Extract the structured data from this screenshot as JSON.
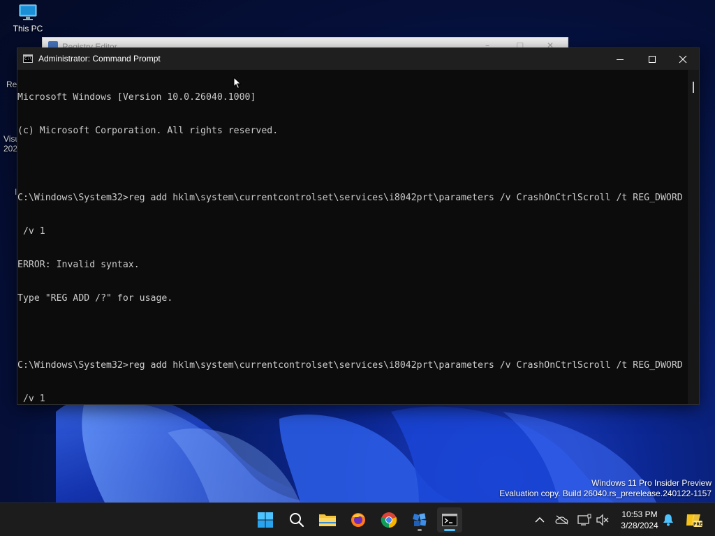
{
  "desktop": {
    "icons": [
      {
        "label": "This PC",
        "icon": "monitor-icon"
      }
    ],
    "partial_labels": [
      "Re",
      "Visu",
      "202",
      "I"
    ],
    "background_window_title": "Registry Editor"
  },
  "console": {
    "title": "Administrator: Command Prompt",
    "lines": [
      "Microsoft Windows [Version 10.0.26040.1000]",
      "(c) Microsoft Corporation. All rights reserved.",
      "",
      "C:\\Windows\\System32>reg add hklm\\system\\currentcontrolset\\services\\i8042prt\\parameters /v CrashOnCtrlScroll /t REG_DWORD",
      " /v 1",
      "ERROR: Invalid syntax.",
      "Type \"REG ADD /?\" for usage.",
      "",
      "C:\\Windows\\System32>reg add hklm\\system\\currentcontrolset\\services\\i8042prt\\parameters /v CrashOnCtrlScroll /t REG_DWORD",
      " /v 1"
    ],
    "controls": [
      "minimize-icon",
      "maximize-icon",
      "close-icon"
    ]
  },
  "watermark": {
    "line1": "Windows 11 Pro Insider Preview",
    "line2": "Evaluation copy. Build 26040.rs_prerelease.240122-1157"
  },
  "taskbar": {
    "apps": [
      "start-icon",
      "search-icon",
      "file-explorer-icon",
      "firefox-icon",
      "chrome-icon",
      "registry-editor-icon",
      "command-prompt-icon"
    ],
    "tray": [
      "chevron-up-icon",
      "onedrive-icon",
      "display-icon",
      "speaker-muted-icon",
      "notification-bell-icon",
      "copilot-icon"
    ],
    "tray_badge": "PRE",
    "clock": {
      "time": "10:53 PM",
      "date": "3/28/2024"
    }
  },
  "colors": {
    "console_bg": "#0c0c0c",
    "console_text": "#cccccc",
    "titlebar": "#1f1f1f",
    "taskbar": "#1c1c1c",
    "accent": "#0078d4"
  }
}
